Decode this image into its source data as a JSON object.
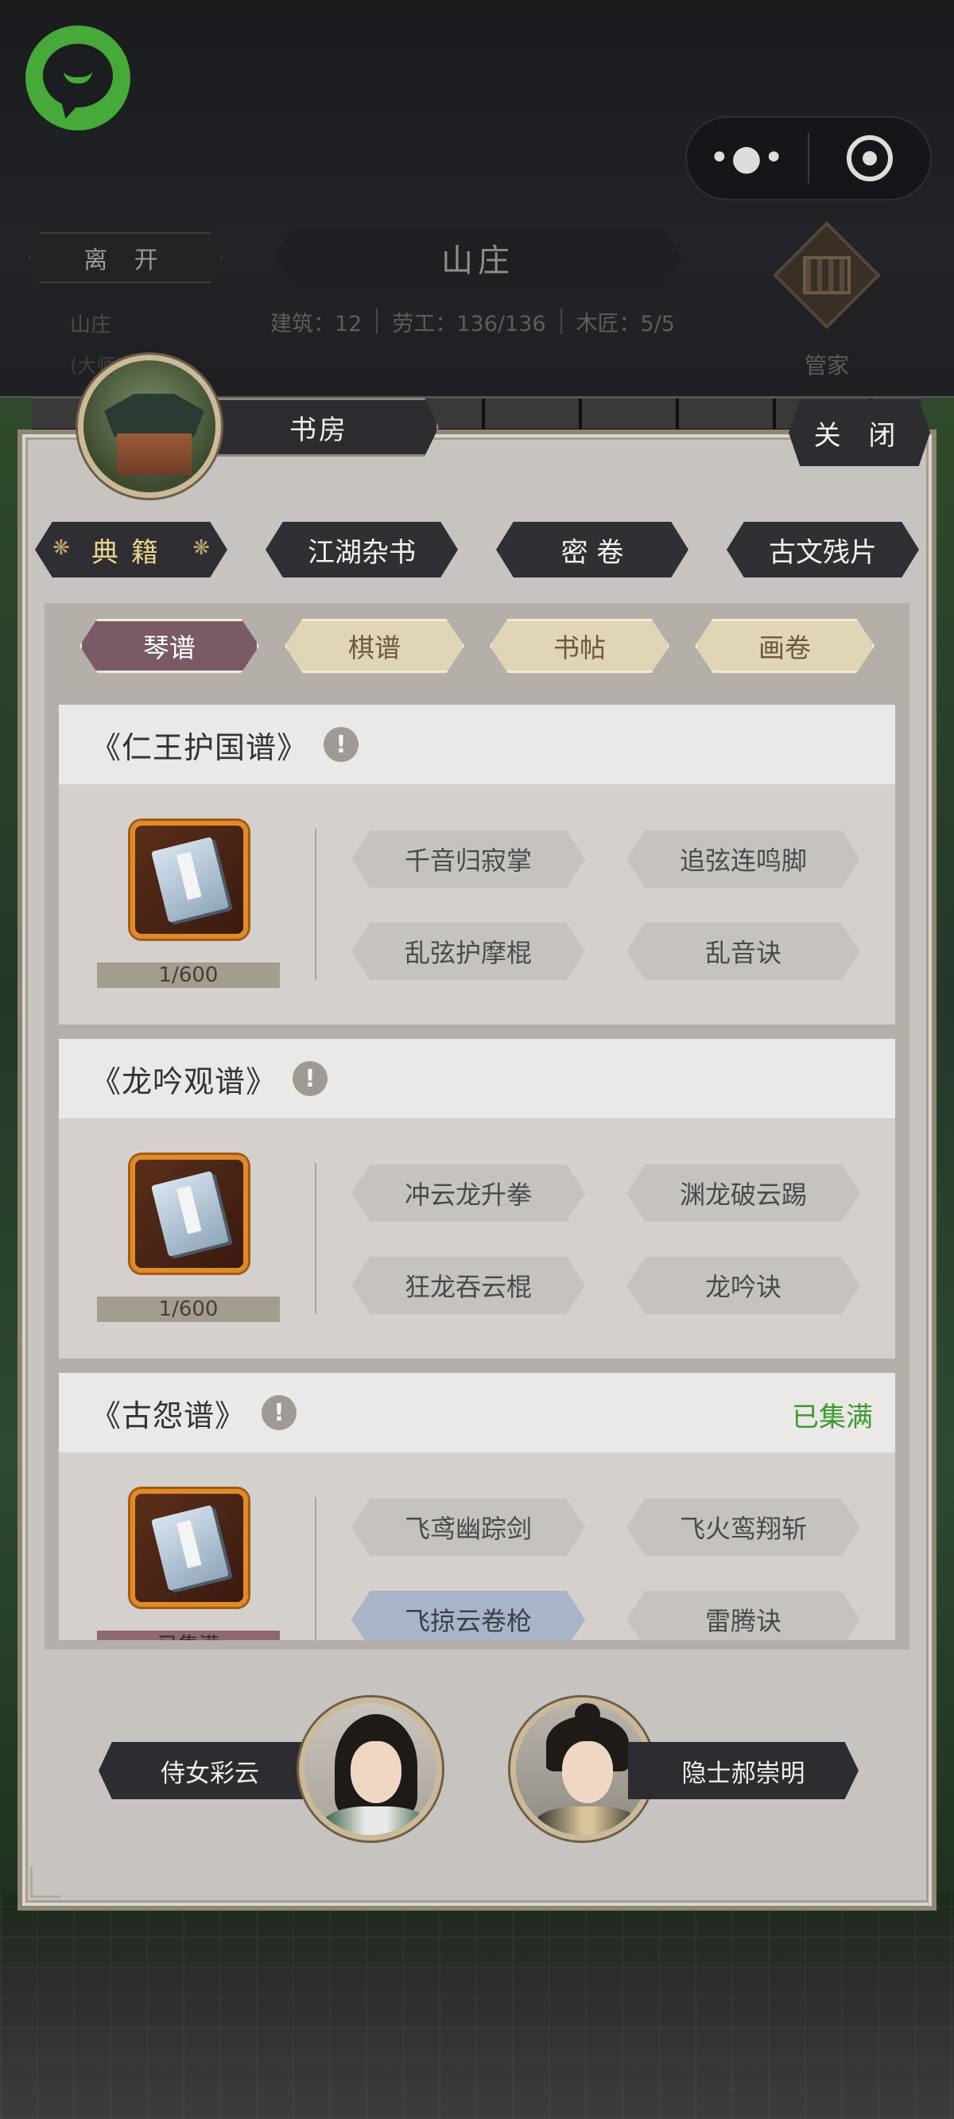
{
  "estate": {
    "leave_label": "离 开",
    "title": "山庄",
    "sub_label": "山庄",
    "sub_label2": "(大师)",
    "buildings": "建筑：12",
    "labor": "劳工：136/136",
    "carpenter": "木匠：5/5",
    "steward_label": "管家"
  },
  "room": {
    "name": "书房",
    "close_label": "关 闭"
  },
  "categories": [
    {
      "label": "典籍",
      "active": true
    },
    {
      "label": "江湖杂书"
    },
    {
      "label": "密 卷"
    },
    {
      "label": "古文残片"
    }
  ],
  "subtabs": [
    {
      "label": "琴谱",
      "active": true
    },
    {
      "label": "棋谱"
    },
    {
      "label": "书帖"
    },
    {
      "label": "画卷"
    }
  ],
  "books": [
    {
      "title": "《仁王护国谱》",
      "progress": "1/600",
      "skills": [
        "千音归寂掌",
        "追弦连鸣脚",
        "乱弦护摩棍",
        "乱音诀"
      ]
    },
    {
      "title": "《龙吟观谱》",
      "progress": "1/600",
      "skills": [
        "冲云龙升拳",
        "渊龙破云踢",
        "狂龙吞云棍",
        "龙吟诀"
      ]
    },
    {
      "title": "《古怨谱》",
      "status": "已集满",
      "progress": "已集满",
      "selected_skill": "飞掠云卷枪",
      "skills": [
        "飞鸢幽踪剑",
        "飞火鸾翔斩",
        "飞掠云卷枪",
        "雷腾诀"
      ]
    }
  ],
  "npcs": {
    "left": "侍女彩云",
    "right": "隐士郝崇明"
  },
  "colors": {
    "accent_green": "#3d9a32",
    "active_subtab": "#7a5a66",
    "panel_bg": "#c7c3c1",
    "app_logo": "#46a93a"
  },
  "icons": [
    "app-logo-icon",
    "more-icon",
    "target-icon",
    "abacus-icon",
    "book-icon",
    "info-icon"
  ]
}
